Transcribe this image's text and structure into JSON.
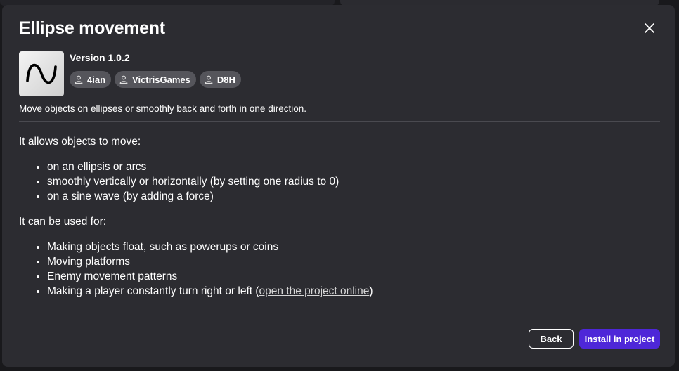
{
  "dialog": {
    "title": "Ellipse movement",
    "version": "Version 1.0.2",
    "authors": [
      "4ian",
      "VictrisGames",
      "D8H"
    ],
    "short_description": "Move objects on ellipses or smoothly back and forth in one direction."
  },
  "content": {
    "intro_1": "It allows objects to move:",
    "list_1": [
      "on an ellipsis or arcs",
      "smoothly vertically or horizontally (by setting one radius to 0)",
      "on a sine wave (by adding a force)"
    ],
    "intro_2": "It can be used for:",
    "list_2": [
      "Making objects float, such as powerups or coins",
      "Moving platforms",
      "Enemy movement patterns"
    ],
    "last_item_prefix": "Making a player constantly turn right or left (",
    "last_item_link": "open the project online",
    "last_item_suffix": ")"
  },
  "buttons": {
    "back": "Back",
    "install": "Install in project"
  },
  "icons": {
    "close": "close-icon",
    "author": "person-icon",
    "thumbnail": "sine-wave-icon"
  },
  "colors": {
    "dialog_bg": "#2c2c31",
    "chip_bg": "#55555b",
    "primary": "#4e27d8"
  }
}
